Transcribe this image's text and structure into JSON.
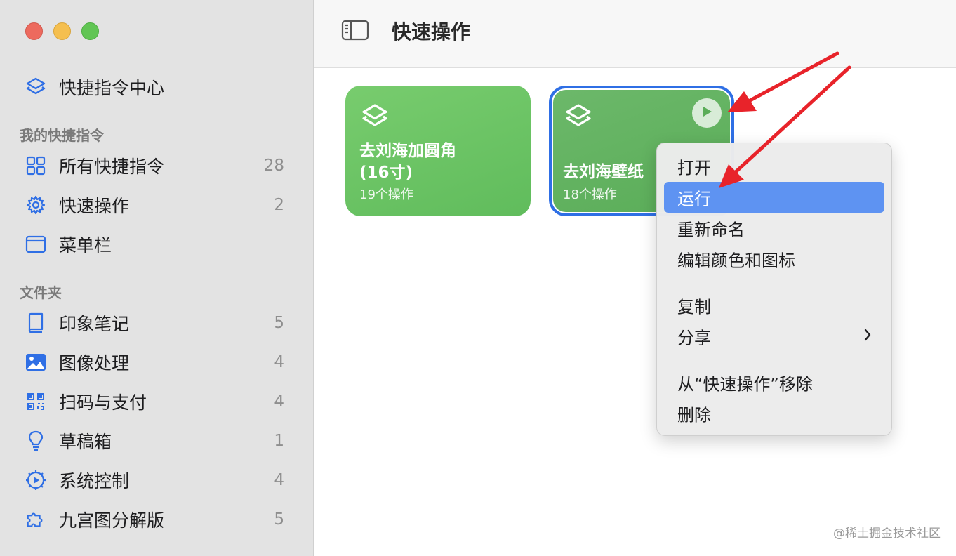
{
  "sidebar": {
    "gallery": {
      "label": "快捷指令中心",
      "icon": "shortcuts-stack-icon"
    },
    "section_my": "我的快捷指令",
    "my_items": [
      {
        "label": "所有快捷指令",
        "count": "28",
        "icon": "grid-icon"
      },
      {
        "label": "快速操作",
        "count": "2",
        "icon": "gear-icon"
      },
      {
        "label": "菜单栏",
        "count": "",
        "icon": "window-icon"
      }
    ],
    "section_folders": "文件夹",
    "folders": [
      {
        "label": "印象笔记",
        "count": "5",
        "icon": "book-icon"
      },
      {
        "label": "图像处理",
        "count": "4",
        "icon": "photo-icon"
      },
      {
        "label": "扫码与支付",
        "count": "4",
        "icon": "qrcode-icon"
      },
      {
        "label": "草稿箱",
        "count": "1",
        "icon": "lightbulb-icon"
      },
      {
        "label": "系统控制",
        "count": "4",
        "icon": "gear-play-icon"
      },
      {
        "label": "九宫图分解版",
        "count": "5",
        "icon": "puzzle-icon"
      }
    ]
  },
  "toolbar": {
    "title": "快速操作",
    "sidebar_toggle_icon": "sidebar-toggle-icon"
  },
  "cards": [
    {
      "title_line1": "去刘海加圆角",
      "title_line2": "(16寸)",
      "subtitle": "19个操作"
    },
    {
      "title_line1": "去刘海壁纸",
      "subtitle": "18个操作",
      "run_icon": "play-icon"
    }
  ],
  "menu": {
    "items": [
      "打开",
      "运行",
      "重新命名",
      "编辑颜色和图标",
      "复制",
      "分享",
      "从“快速操作”移除",
      "删除"
    ],
    "active_index": 1
  },
  "colors": {
    "accent": "#2f6fe5",
    "card_green": "#6cc466",
    "menu_highlight": "#5e93f2",
    "arrow_red": "#e8232a"
  },
  "watermark": "@稀土掘金技术社区"
}
